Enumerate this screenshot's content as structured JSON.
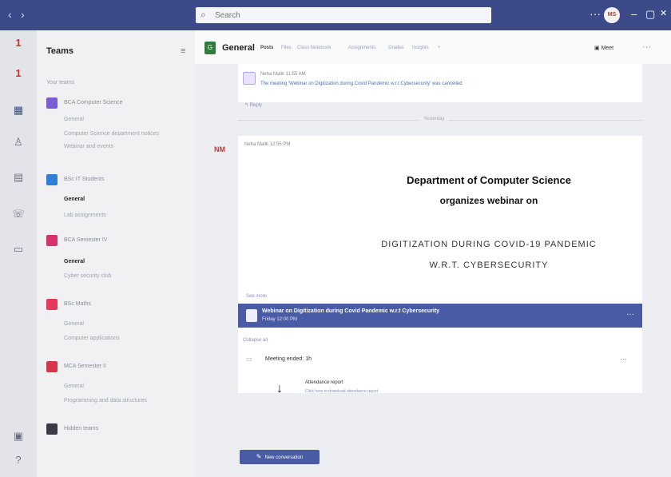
{
  "topbar": {
    "back": "‹",
    "forward": "›",
    "search_placeholder": "Search",
    "more": "···",
    "avatar_initials": "MS",
    "minimize": "–",
    "maximize": "▢",
    "close": "✕"
  },
  "rail": {
    "activity_badge": "1",
    "chat_badge": "1"
  },
  "teams_panel": {
    "title": "Teams",
    "filter_icon": "≡",
    "section_label": "Your teams",
    "teams": [
      {
        "name": "BCA Computer Science",
        "color": "#7a5cd6",
        "channels": [
          {
            "name": "General",
            "bold": false
          },
          {
            "name": "Computer Science department notices",
            "bold": false
          },
          {
            "name": "Webinar and events",
            "bold": false
          }
        ]
      },
      {
        "name": "BSc IT Students",
        "color": "#2e7fd8",
        "channels": [
          {
            "name": "General",
            "bold": true
          },
          {
            "name": "Lab assignments",
            "bold": false
          }
        ]
      },
      {
        "name": "BCA Semester IV",
        "color": "#d6336c",
        "channels": [
          {
            "name": "General",
            "bold": true
          },
          {
            "name": "Cyber security club",
            "bold": false
          }
        ]
      },
      {
        "name": "BSc Maths",
        "color": "#e23a5a",
        "channels": [
          {
            "name": "General",
            "bold": false
          },
          {
            "name": "Computer applications",
            "bold": false
          }
        ]
      },
      {
        "name": "MCA Semester II",
        "color": "#d4374a",
        "channels": [
          {
            "name": "General",
            "bold": false
          },
          {
            "name": "Programming and data structures",
            "bold": false
          }
        ]
      },
      {
        "name": "Hidden teams",
        "color": "#3a3a44",
        "channels": [
          {
            "name": "",
            "bold": false
          }
        ]
      }
    ]
  },
  "channel_header": {
    "team_icon_label": "G",
    "name": "General",
    "tabs": [
      "Posts",
      "Files",
      "Class Notebook",
      "Assignments",
      "Grades",
      "Insights",
      "+"
    ],
    "meet_label": "Meet",
    "more_icon": "···"
  },
  "feed": {
    "first_post": {
      "author": "Neha Malik  11:55 AM",
      "text": "The meeting 'Webinar on Digitization during Covid Pandemic w.r.t Cybersecurity' was cancelled",
      "reply": "↰ Reply"
    },
    "date_divider": "Yesterday",
    "webinar_post": {
      "author_initials": "NM",
      "author": "Neha Malik  12:55 PM",
      "flyer_line1": "Department of Computer Science",
      "flyer_line2": "organizes webinar on",
      "flyer_line3": "DIGITIZATION DURING COVID-19 PANDEMIC",
      "flyer_line4": "W.R.T. CYBERSECURITY",
      "seen": "See more"
    },
    "meeting_bar": {
      "title": "Webinar on Digitization during Covid Pandemic w.r.t Cybersecurity",
      "time": "Friday 12:00 PM",
      "options_icon": "···"
    },
    "collapse_all": "Collapse all",
    "meeting_ended": "Meeting ended: 1h",
    "ended_more": "···",
    "attendance_title": "Attendance report",
    "attendance_desc": "Click here to download attendance report",
    "download_icon": "↓",
    "new_conversation": "New conversation"
  }
}
